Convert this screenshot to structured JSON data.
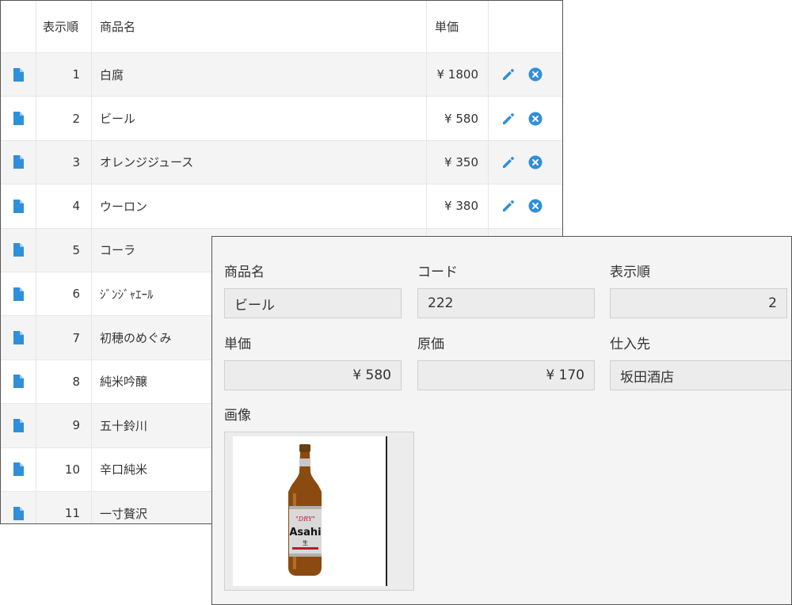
{
  "list": {
    "headers": {
      "order": "表示順",
      "name": "商品名",
      "price": "単価"
    },
    "rows": [
      {
        "order": "1",
        "name": "白腐",
        "price": "¥ 1800"
      },
      {
        "order": "2",
        "name": "ビール",
        "price": "¥ 580"
      },
      {
        "order": "3",
        "name": "オレンジジュース",
        "price": "¥ 350"
      },
      {
        "order": "4",
        "name": "ウーロン",
        "price": "¥ 380"
      },
      {
        "order": "5",
        "name": "コーラ",
        "price": ""
      },
      {
        "order": "6",
        "name": "ｼﾞﾝｼﾞｬｴｰﾙ",
        "price": ""
      },
      {
        "order": "7",
        "name": "初穂のめぐみ",
        "price": ""
      },
      {
        "order": "8",
        "name": "純米吟醸",
        "price": ""
      },
      {
        "order": "9",
        "name": "五十鈴川",
        "price": ""
      },
      {
        "order": "10",
        "name": "辛口純米",
        "price": ""
      },
      {
        "order": "11",
        "name": "一寸贅沢",
        "price": ""
      }
    ]
  },
  "detail": {
    "name": {
      "label": "商品名",
      "value": "ビール"
    },
    "code": {
      "label": "コード",
      "value": "222"
    },
    "order": {
      "label": "表示順",
      "value": "2"
    },
    "price": {
      "label": "単価",
      "value": "¥ 580"
    },
    "cost": {
      "label": "原価",
      "value": "¥ 170"
    },
    "supplier": {
      "label": "仕入先",
      "value": "坂田酒店"
    },
    "image": {
      "label": "画像"
    },
    "bottle": {
      "brand": "Asahi",
      "line": "\"DRY\"",
      "kanji": "生"
    }
  },
  "colors": {
    "accent": "#2f8fd8",
    "row_alt": "#f4f4f4",
    "panel_bg": "#f4f4f4"
  }
}
